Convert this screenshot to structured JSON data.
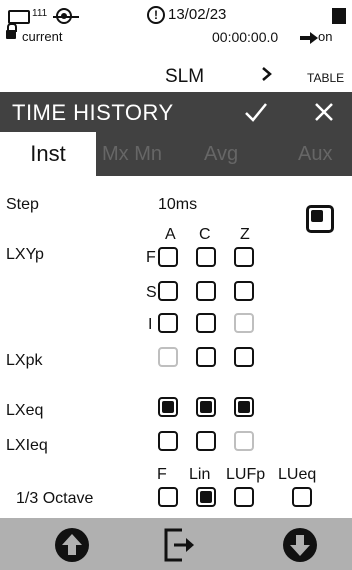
{
  "status_bar": {
    "battery_small_label": "111",
    "date": "13/02/23",
    "lock_label": "current",
    "timer": "00:00:00.0",
    "power_state": "on"
  },
  "nav": {
    "current": "SLM",
    "next": "TABLE"
  },
  "header": {
    "title": "TIME HISTORY"
  },
  "tabs": [
    {
      "label": "Inst",
      "active": true
    },
    {
      "label": "Mx Mn",
      "active": false
    },
    {
      "label": "Avg",
      "active": false
    },
    {
      "label": "Aux",
      "active": false
    }
  ],
  "settings": {
    "step_label": "Step",
    "step_value": "10ms",
    "step_checkbox": true,
    "columns_main": [
      "A",
      "C",
      "Z"
    ],
    "lxyp_label": "LXYp",
    "row_labels": [
      "F",
      "S",
      "I"
    ],
    "lxpk_label": "LXpk",
    "lxeq_label": "LXeq",
    "lxieq_label": "LXIeq",
    "octave_label": "1/3 Octave",
    "octave_columns": [
      "F",
      "Lin",
      "LUFp",
      "LUeq"
    ]
  },
  "colors": {
    "header_bg": "#414141",
    "tab_inactive_text": "#666666",
    "bottom_bar": "#b0b0b0",
    "disabled_checkbox": "#bfbfbf"
  },
  "icons": {
    "battery_small": "battery-small-icon",
    "gps": "gps-icon",
    "alert": "alert-icon",
    "battery": "battery-full-icon",
    "lock": "lock-icon",
    "arrow": "arrow-right-icon",
    "chevron": "chevron-right-icon",
    "check": "check-icon",
    "close": "close-icon",
    "up": "arrow-up-circle-icon",
    "exit": "exit-icon",
    "down": "arrow-down-circle-icon"
  }
}
